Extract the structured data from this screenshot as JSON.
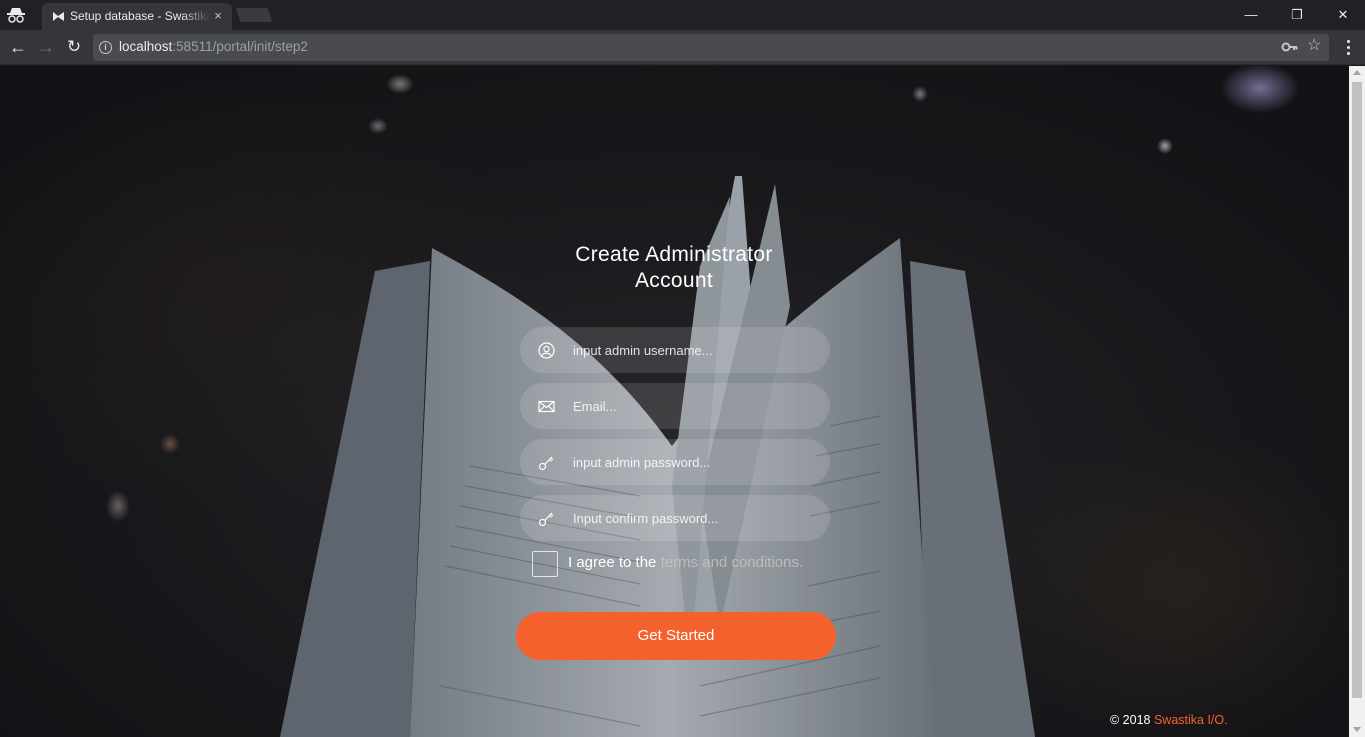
{
  "browser": {
    "tab_title": "Setup database - Swastika",
    "tab_close": "×",
    "url_host": "localhost",
    "url_rest": ":58511/portal/init/step2",
    "window_minimize": "—",
    "window_maximize": "❐",
    "window_close": "✕"
  },
  "page": {
    "heading_line1": "Create Administrator",
    "heading_line2": "Account",
    "username_placeholder": "input admin username...",
    "email_placeholder": "Email...",
    "password_placeholder": "input admin password...",
    "confirm_placeholder": "Input confirm password...",
    "agree_prefix": "I agree to the ",
    "agree_link": "terms and conditions.",
    "submit_label": "Get Started",
    "footer_prefix": "© 2018 ",
    "footer_brand": "Swastika I/O."
  },
  "colors": {
    "accent": "#f5612d",
    "chrome_dark": "#202124",
    "chrome_toolbar": "#35363a"
  },
  "icons": [
    "incognito-icon",
    "tab-favicon-icon",
    "back-icon",
    "forward-icon",
    "reload-icon",
    "info-icon",
    "key-icon",
    "star-icon",
    "menu-icon",
    "user-icon",
    "mail-icon",
    "key-icon"
  ]
}
